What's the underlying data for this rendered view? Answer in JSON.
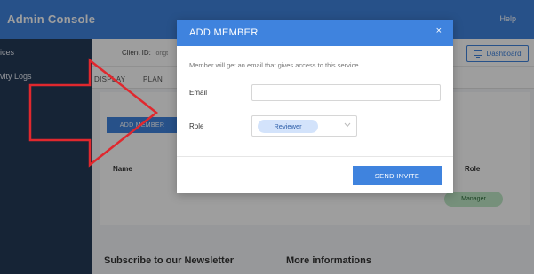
{
  "header": {
    "app_title": "Admin Console",
    "help_label": "Help"
  },
  "sidebar": {
    "items": [
      {
        "label": "ices"
      },
      {
        "label": "vity Logs"
      }
    ]
  },
  "subheader": {
    "client_id_label": "Client ID:",
    "client_id_value": "longt",
    "dashboard_label": "Dashboard"
  },
  "tabs": [
    {
      "label": "DISPLAY"
    },
    {
      "label": "PLAN"
    }
  ],
  "members": {
    "add_button_label": "ADD MEMBER",
    "columns": {
      "name": "Name",
      "role": "Role"
    },
    "rows": [
      {
        "role": "Manager"
      }
    ]
  },
  "footer": {
    "newsletter_heading": "Subscribe to our Newsletter",
    "more_info_heading": "More informations"
  },
  "modal": {
    "title": "ADD MEMBER",
    "close_symbol": "×",
    "description": "Member will get an email that gives access to this service.",
    "email_label": "Email",
    "email_value": "",
    "email_placeholder": "",
    "role_label": "Role",
    "role_selected": "Reviewer",
    "send_button_label": "SEND INVITE"
  },
  "icons": {
    "dashboard": "monitor-icon",
    "role_dropdown": "chevron-down-icon",
    "annotation": "red-arrow-icon"
  },
  "colors": {
    "primary": "#3f83de",
    "sidebar": "#253a58",
    "arrow": "#e0282e",
    "role_chip": "#d3e3fb",
    "manager_badge": "#bfe8c7"
  }
}
